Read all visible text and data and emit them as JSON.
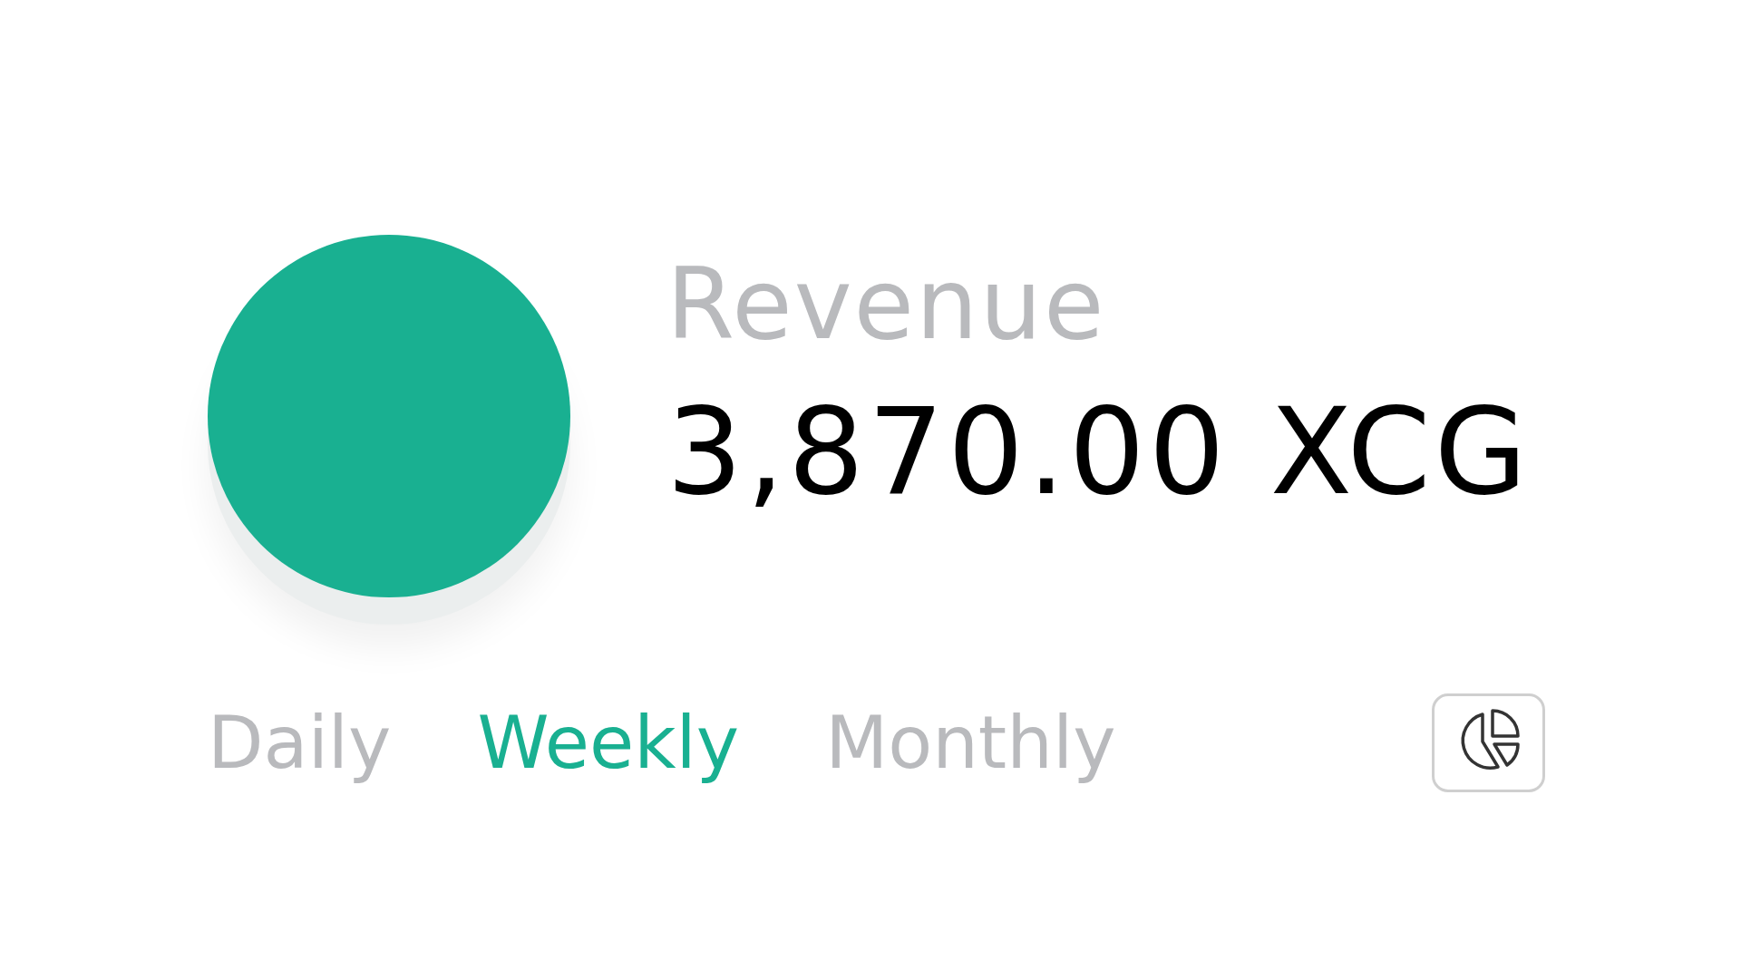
{
  "metric": {
    "label": "Revenue",
    "value": "3,870.00 XCG"
  },
  "periods": [
    {
      "label": "Daily",
      "selected": false
    },
    {
      "label": "Weekly",
      "selected": true
    },
    {
      "label": "Monthly",
      "selected": false
    }
  ]
}
